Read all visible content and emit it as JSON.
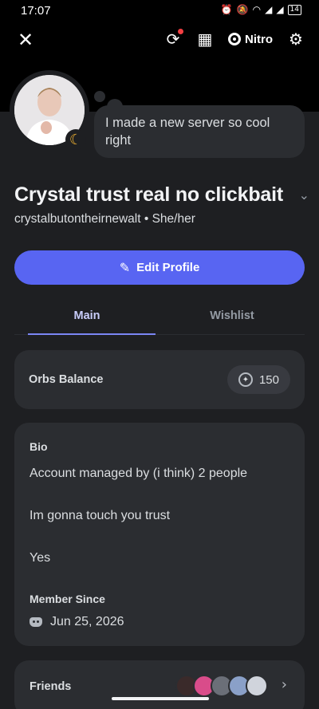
{
  "statusbar": {
    "time": "17:07",
    "icons": [
      "alarm-icon",
      "mute-icon",
      "wifi-icon",
      "signal-icon",
      "signal-icon",
      "battery-icon"
    ],
    "battery": "14"
  },
  "topbar": {
    "close_icon": "close-icon",
    "nitro_label": "Nitro"
  },
  "profile": {
    "custom_status": "I made a new server so cool right",
    "display_name": "Crystal trust real no clickbait",
    "username": "crystalbutontheirnewalt",
    "pronouns": "She/her",
    "separator": "•"
  },
  "actions": {
    "edit_profile": "Edit Profile"
  },
  "tabs": [
    {
      "label": "Main",
      "active": true
    },
    {
      "label": "Wishlist",
      "active": false
    }
  ],
  "orbs": {
    "label": "Orbs Balance",
    "value": "150"
  },
  "bio": {
    "label": "Bio",
    "lines": [
      "Account managed by (i think) 2 people",
      "Im gonna touch you trust",
      "Yes"
    ]
  },
  "member_since": {
    "label": "Member Since",
    "date": "Jun 25, 2026"
  },
  "friends": {
    "label": "Friends",
    "avatar_colors": [
      "#3a2a2a",
      "#d94c8a",
      "#6b6f78",
      "#8aa0c8",
      "#d0d4dc"
    ]
  },
  "colors": {
    "accent": "#5865f2",
    "background": "#1e1f22",
    "card": "#2b2d31",
    "idle_status": "#f0b232"
  }
}
